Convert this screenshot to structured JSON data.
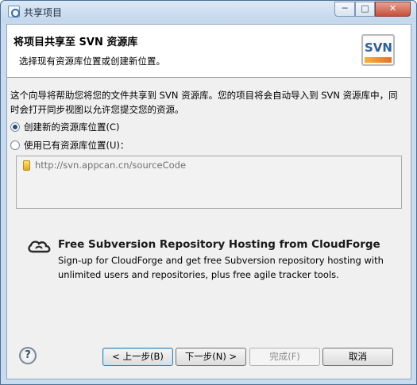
{
  "window": {
    "title": "共享项目",
    "min_glyph": "─",
    "max_glyph": "□",
    "close_glyph": "✕"
  },
  "header": {
    "title": "将项目共享至 SVN 资源库",
    "subtitle": "选择现有资源库位置或创建新位置。",
    "logo_text": "SVN"
  },
  "description": "这个向导将帮助您将您的文件共享到 SVN 资源库。您的项目将会自动导入到 SVN 资源库中，同时会打开同步视图以允许您提交您的资源。",
  "options": {
    "create_label": "创建新的资源库位置(C)",
    "use_label": "使用已有资源库位置(U)："
  },
  "repositories": [
    {
      "url": "http://svn.appcan.cn/sourceCode"
    }
  ],
  "promo": {
    "title": "Free Subversion Repository Hosting from CloudForge",
    "description": "Sign-up for CloudForge and get free Subversion repository hosting with unlimited users and repositories, plus free agile tracker tools."
  },
  "buttons": {
    "help": "?",
    "back": "< 上一步(B)",
    "next": "下一步(N) >",
    "finish": "完成(F)",
    "cancel": "取消"
  }
}
